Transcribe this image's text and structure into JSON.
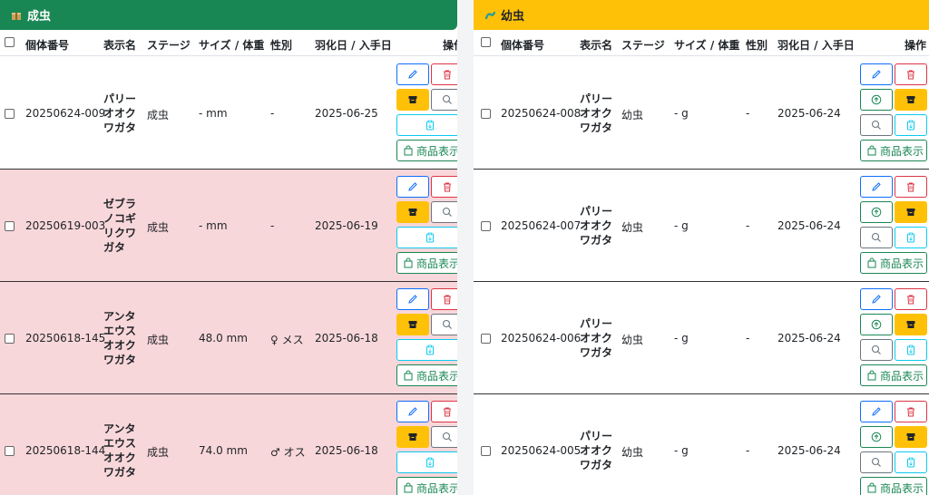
{
  "adult_panel": {
    "title": "成虫",
    "icon": "package-icon",
    "columns": [
      "個体番号",
      "表示名",
      "ステージ",
      "サイズ / 体重",
      "性別",
      "羽化日 / 入手日",
      "操作"
    ],
    "rows": [
      {
        "id": "20250624-009",
        "name": "パリーオオクワガタ",
        "stage": "成虫",
        "size": "- mm",
        "sex": "-",
        "date": "2025-06-25",
        "highlight": false
      },
      {
        "id": "20250619-003",
        "name": "ゼブラノコギリクワガタ",
        "stage": "成虫",
        "size": "- mm",
        "sex": "-",
        "date": "2025-06-19",
        "highlight": true
      },
      {
        "id": "20250618-145",
        "name": "アンタエウスオオクワガタ",
        "stage": "成虫",
        "size": "48.0 mm",
        "sex": "♀ メス",
        "date": "2025-06-18",
        "highlight": true
      },
      {
        "id": "20250618-144",
        "name": "アンタエウスオオクワガタ",
        "stage": "成虫",
        "size": "74.0 mm",
        "sex": "♂ オス",
        "date": "2025-06-18",
        "highlight": true
      }
    ],
    "shop_label": "商品表示"
  },
  "larva_panel": {
    "title": "幼虫",
    "icon": "worm-icon",
    "columns": [
      "個体番号",
      "表示名",
      "ステージ",
      "サイズ / 体重",
      "性別",
      "羽化日 / 入手日",
      "操作"
    ],
    "rows": [
      {
        "id": "20250624-008",
        "name": "パリーオオクワガタ",
        "stage": "幼虫",
        "size": "- g",
        "sex": "-",
        "date": "2025-06-24"
      },
      {
        "id": "20250624-007",
        "name": "パリーオオクワガタ",
        "stage": "幼虫",
        "size": "- g",
        "sex": "-",
        "date": "2025-06-24"
      },
      {
        "id": "20250624-006",
        "name": "パリーオオクワガタ",
        "stage": "幼虫",
        "size": "- g",
        "sex": "-",
        "date": "2025-06-24"
      },
      {
        "id": "20250624-005",
        "name": "パリーオオクワガタ",
        "stage": "幼虫",
        "size": "- g",
        "sex": "-",
        "date": "2025-06-24"
      }
    ],
    "shop_label": "商品表示"
  },
  "colors": {
    "adult_header": "#198754",
    "larva_header": "#ffc107",
    "row_highlight": "#f8d7da"
  }
}
